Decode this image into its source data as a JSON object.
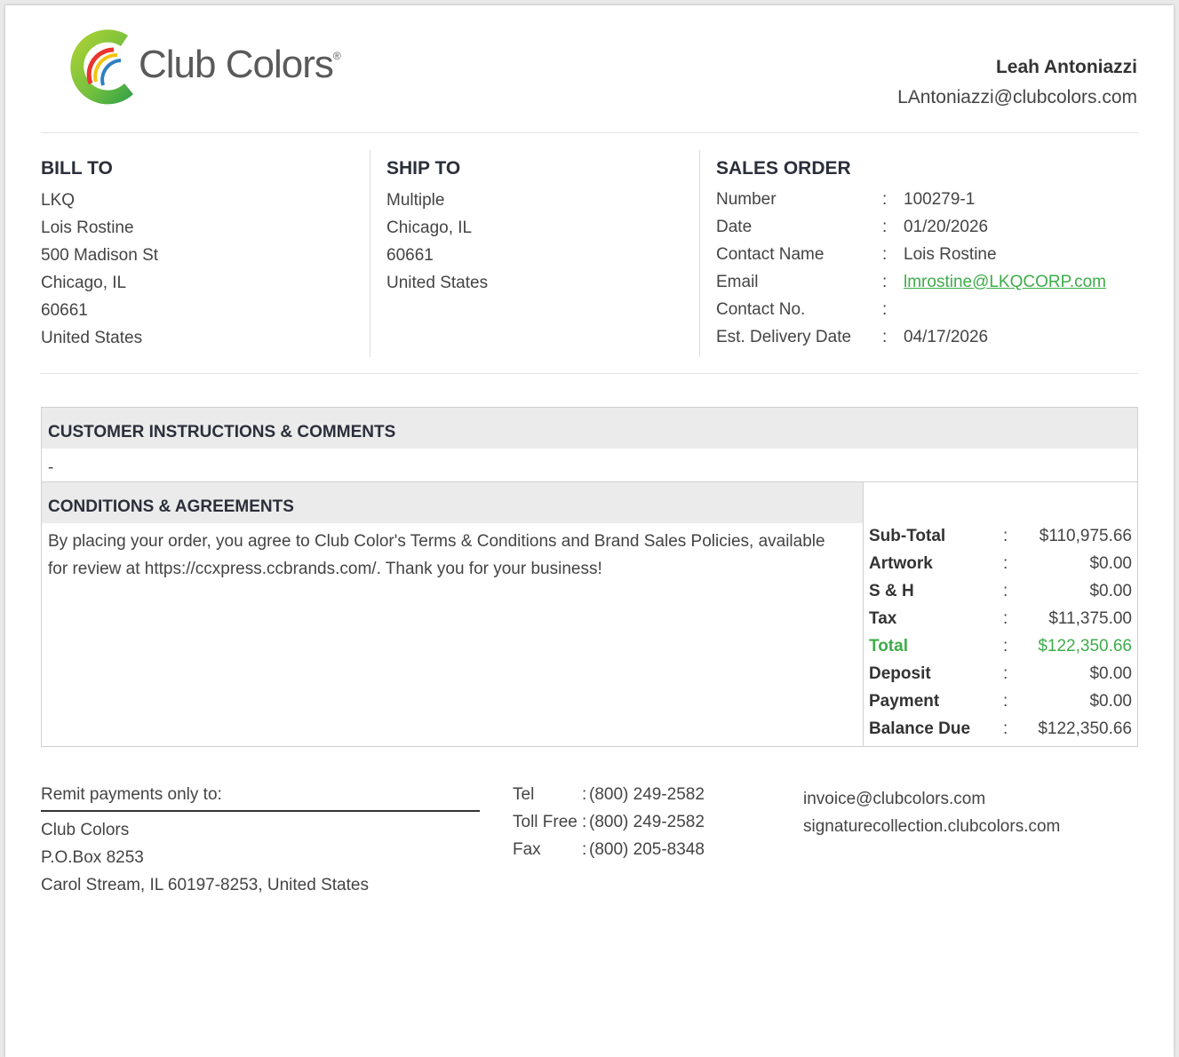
{
  "header": {
    "logo_text": "Club Colors",
    "logo_mark": "®",
    "rep_name": "Leah Antoniazzi",
    "rep_email": "LAntoniazzi@clubcolors.com"
  },
  "bill_to": {
    "title": "BILL TO",
    "lines": [
      "LKQ",
      "Lois Rostine",
      "500 Madison St",
      "Chicago, IL",
      "60661",
      "United States"
    ]
  },
  "ship_to": {
    "title": "SHIP TO",
    "lines": [
      "Multiple",
      "Chicago, IL",
      "60661",
      "United States"
    ]
  },
  "sales_order": {
    "title": "SALES ORDER",
    "fields": [
      {
        "label": "Number",
        "value": "100279-1"
      },
      {
        "label": "Date",
        "value": "01/20/2026"
      },
      {
        "label": "Contact Name",
        "value": "Lois Rostine"
      },
      {
        "label": "Email",
        "value": "lmrostine@LKQCORP.com"
      },
      {
        "label": "Contact No.",
        "value": ""
      },
      {
        "label": "Est. Delivery Date",
        "value": "04/17/2026"
      }
    ],
    "separator": ":"
  },
  "instructions": {
    "title": "CUSTOMER INSTRUCTIONS & COMMENTS",
    "text": "-"
  },
  "conditions": {
    "title": "CONDITIONS & AGREEMENTS",
    "line1": "By placing your order, you agree to Club Color's Terms & Conditions and Brand Sales Policies, available",
    "line2": "for review at https://ccxpress.ccbrands.com/. Thank you for your business!"
  },
  "totals": [
    {
      "label": "Sub-Total",
      "value": "$110,975.66"
    },
    {
      "label": "Artwork",
      "value": "$0.00"
    },
    {
      "label": "S & H",
      "value": "$0.00"
    },
    {
      "label": "Tax",
      "value": "$11,375.00"
    },
    {
      "label": "Total",
      "value": "$122,350.66"
    },
    {
      "label": "Deposit",
      "value": "$0.00"
    },
    {
      "label": "Payment",
      "value": "$0.00"
    },
    {
      "label": "Balance Due",
      "value": "$122,350.66"
    }
  ],
  "footer": {
    "remit_title": "Remit payments only to:",
    "remit_lines": [
      "Club Colors",
      "P.O.Box 8253",
      "Carol Stream, IL 60197-8253, United States"
    ],
    "contacts": [
      {
        "label": "Tel",
        "value": "(800) 249-2582"
      },
      {
        "label": "Toll Free",
        "value": "(800) 249-2582"
      },
      {
        "label": "Fax",
        "value": "(800) 205-8348"
      }
    ],
    "web_lines": [
      "invoice@clubcolors.com",
      "signaturecollection.clubcolors.com"
    ]
  },
  "colors": {
    "accent_green": "#3eac4a",
    "heading": "#2a2f3a"
  }
}
